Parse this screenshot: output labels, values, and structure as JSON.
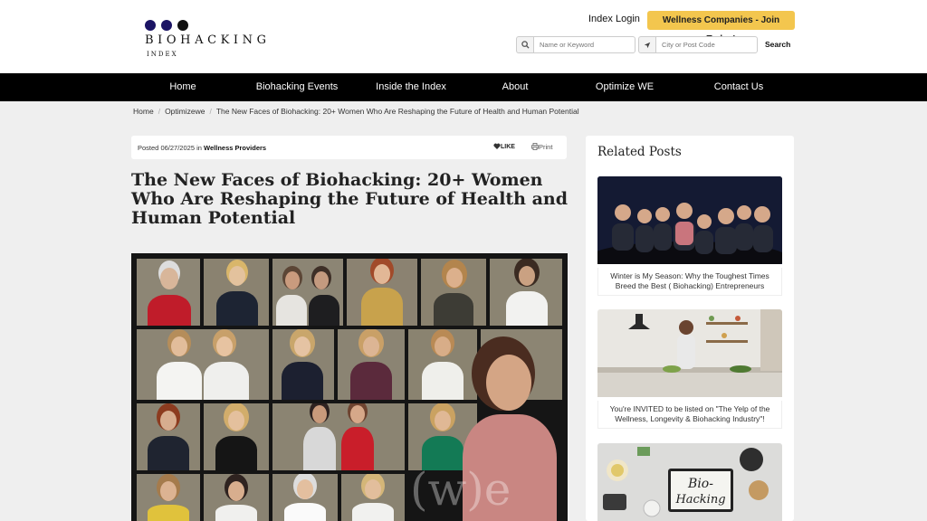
{
  "header": {
    "logo_main": "BIOHACKING",
    "logo_sub": "INDEX",
    "login_label": "Index Login",
    "join_label": "Wellness Companies - Join Today!",
    "search_keyword_placeholder": "Name or Keyword",
    "search_city_placeholder": "City or Post Code",
    "search_button": "Search"
  },
  "nav": {
    "items": [
      {
        "label": "Home"
      },
      {
        "label": "Biohacking Events"
      },
      {
        "label": "Inside the Index"
      },
      {
        "label": "About"
      },
      {
        "label": "Optimize WE"
      },
      {
        "label": "Contact Us"
      }
    ]
  },
  "breadcrumb": [
    "Home",
    "Optimizewe",
    "The New Faces of Biohacking: 20+ Women Who Are Reshaping the Future of Health and Human Potential"
  ],
  "post": {
    "posted_prefix": "Posted",
    "date": "06/27/2025",
    "in_word": "in",
    "category": "Wellness Providers",
    "like_label": "LIKE",
    "print_label": "Print",
    "title": "The New Faces of Biohacking: 20+ Women Who Are Reshaping the Future of Health and Human Potential",
    "hero_watermark": "(w)e"
  },
  "sidebar": {
    "title": "Related Posts",
    "posts": [
      {
        "caption": "Winter is My Season: Why the Toughest Times Breed the Best ( Biohacking) Entrepreneurs"
      },
      {
        "caption": "You're INVITED to be listed on \"The Yelp of the Wellness, Longevity & Biohacking Industry\"!"
      },
      {
        "caption": "",
        "image_text": "Bio-Hacking"
      }
    ]
  },
  "colors": {
    "accent_button": "#f3c64e",
    "nav_bg": "#000000",
    "logo_dot": "#1b1464"
  },
  "icons": [
    "search-icon",
    "location-arrow-icon",
    "heart-icon",
    "print-icon"
  ]
}
